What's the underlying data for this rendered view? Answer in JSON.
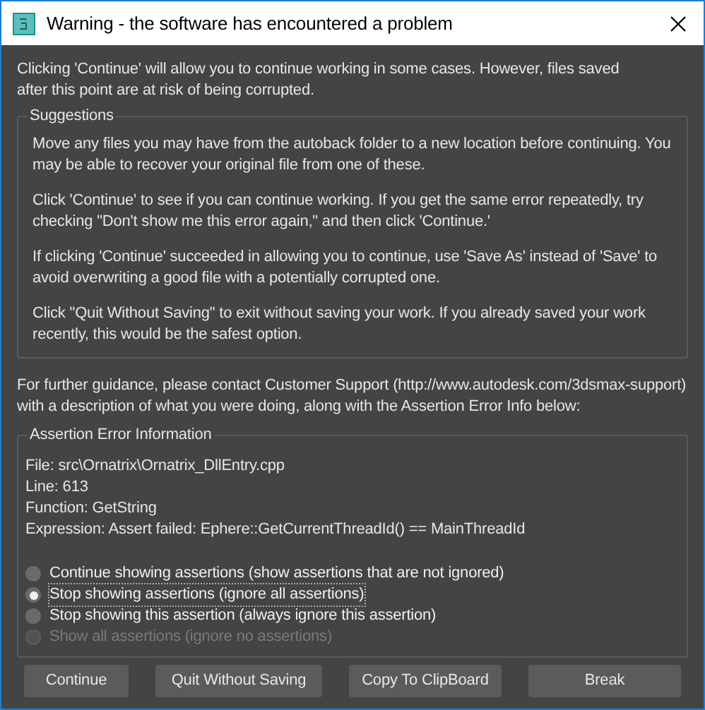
{
  "window": {
    "title": "Warning - the software has encountered a problem"
  },
  "intro": "Clicking 'Continue' will allow you to continue working in some cases. However, files saved after this point are at risk of being corrupted.",
  "suggestions": {
    "title": "Suggestions",
    "paragraphs": [
      "Move any files you may have from the autoback folder to a new location before continuing. You may be able to recover your original file from one of these.",
      "Click 'Continue' to see if you can continue working. If you get the same error repeatedly, try checking \"Don't show me this error again,\" and then click 'Continue.'",
      "If clicking 'Continue' succeeded in allowing you to continue, use 'Save As' instead of 'Save' to avoid overwriting a good file with a potentially corrupted one.",
      "Click \"Quit Without Saving\" to exit without saving your work. If you already saved your work recently, this would be the safest option."
    ]
  },
  "guidance": "For further guidance, please contact Customer Support (http://www.autodesk.com/3dsmax-support) with a description of what you were doing, along with the Assertion Error Info below:",
  "assertion": {
    "title": "Assertion Error Information",
    "lines": [
      "File: src\\Ornatrix\\Ornatrix_DllEntry.cpp",
      "Line: 613",
      "Function: GetString",
      "Expression: Assert failed: Ephere::GetCurrentThreadId() == MainThreadId"
    ],
    "options": [
      {
        "label": "Continue showing assertions (show assertions that are not ignored)",
        "selected": false,
        "disabled": false
      },
      {
        "label": "Stop showing assertions (ignore all assertions)",
        "selected": true,
        "disabled": false
      },
      {
        "label": "Stop showing this assertion (always ignore this assertion)",
        "selected": false,
        "disabled": false
      },
      {
        "label": "Show all assertions (ignore no assertions)",
        "selected": false,
        "disabled": true
      }
    ]
  },
  "buttons": [
    "Continue",
    "Quit Without Saving",
    "Copy To ClipBoard",
    "Break"
  ]
}
